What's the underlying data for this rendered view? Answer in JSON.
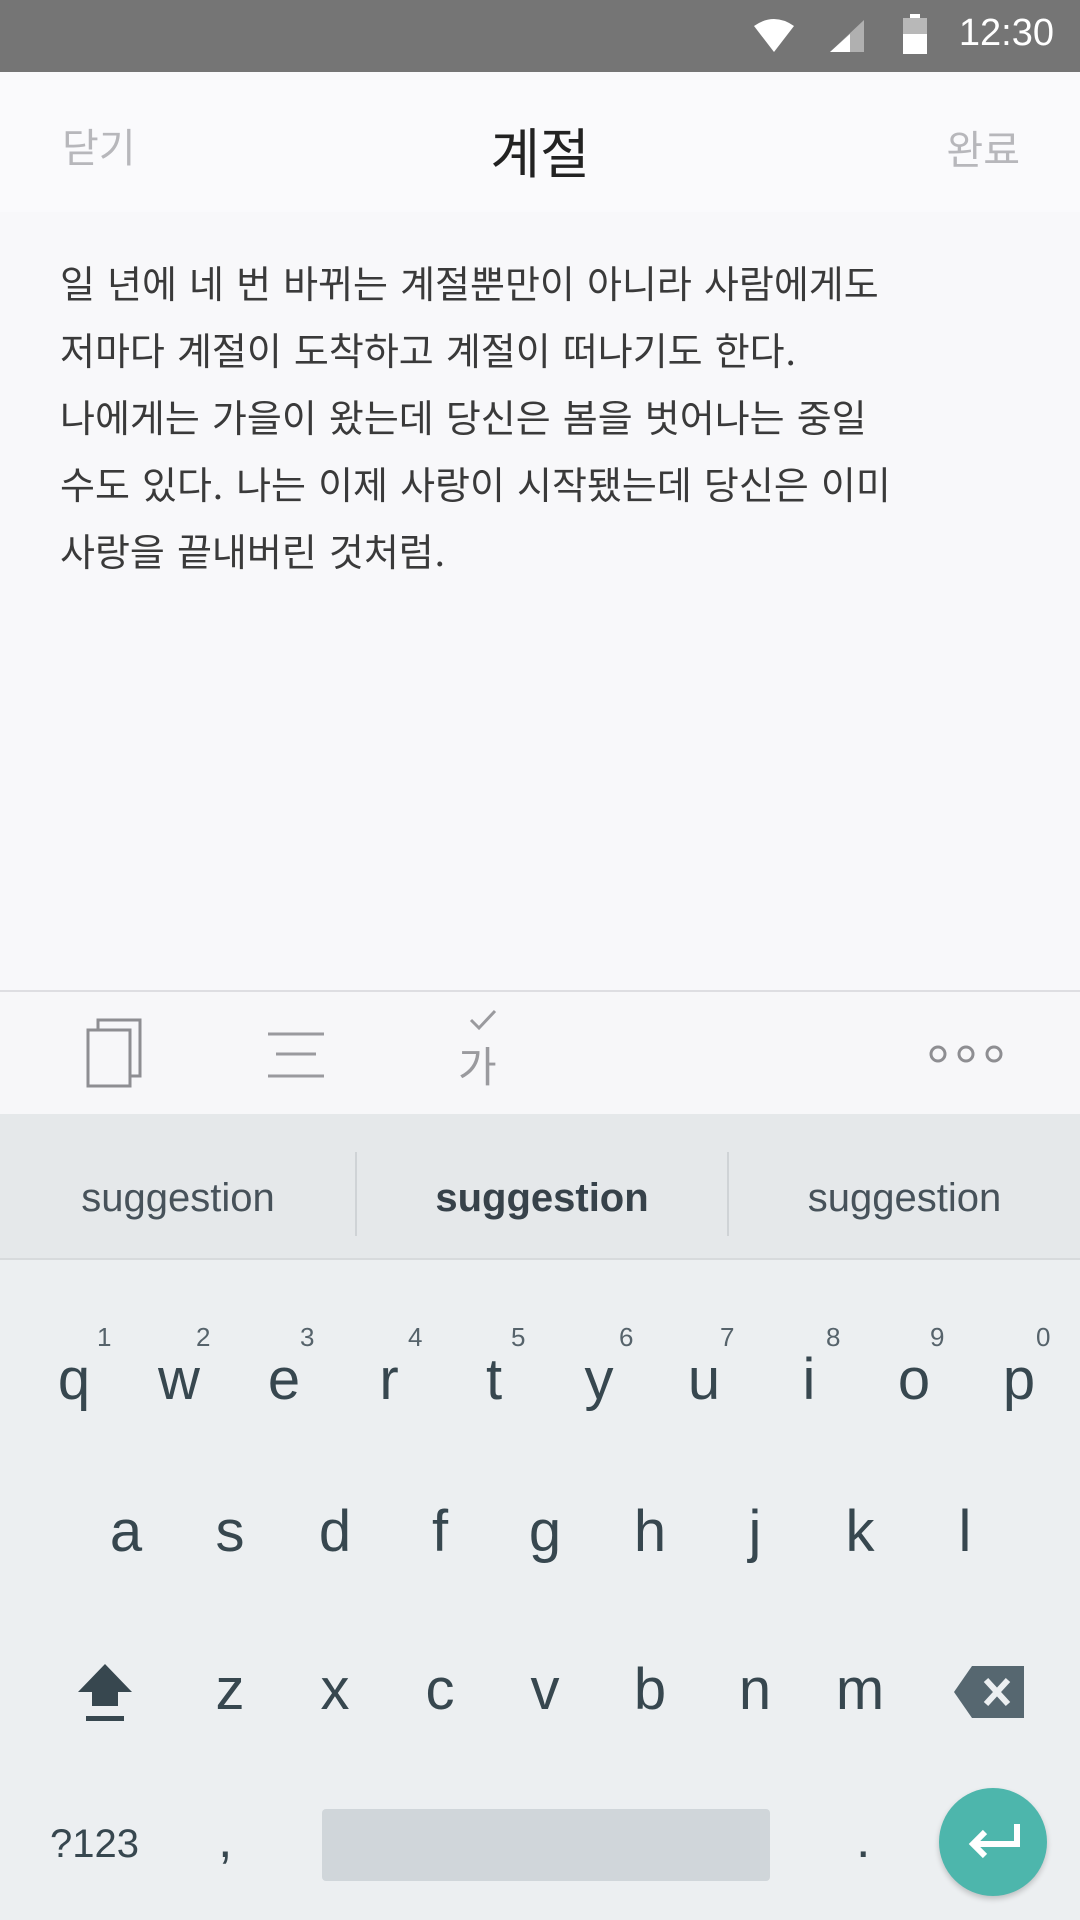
{
  "status_bar": {
    "time": "12:30",
    "icons": [
      "wifi-icon",
      "cell-signal-icon",
      "battery-icon"
    ]
  },
  "header": {
    "close_label": "닫기",
    "title": "계절",
    "done_label": "완료"
  },
  "editor": {
    "lines": [
      "일 년에 네 번 바뀌는 계절뿐만이 아니라 사람에게도",
      "저마다 계절이 도착하고 계절이 떠나기도 한다.",
      "나에게는 가을이 왔는데 당신은 봄을 벗어나는 중일",
      "수도 있다. 나는 이제 사랑이 시작됐는데 당신은 이미",
      "사랑을 끝내버린 것처럼."
    ]
  },
  "toolbar": {
    "tools": [
      "copy-icon",
      "align-icon",
      "spellcheck-icon",
      "more-icon"
    ],
    "spellcheck_glyph": "가"
  },
  "keyboard": {
    "suggestions": [
      "suggestion",
      "suggestion",
      "suggestion"
    ],
    "row1": [
      "q",
      "w",
      "e",
      "r",
      "t",
      "y",
      "u",
      "i",
      "o",
      "p"
    ],
    "row1_hints": [
      "1",
      "2",
      "3",
      "4",
      "5",
      "6",
      "7",
      "8",
      "9",
      "0"
    ],
    "row2": [
      "a",
      "s",
      "d",
      "f",
      "g",
      "h",
      "j",
      "k",
      "l"
    ],
    "row3": [
      "z",
      "x",
      "c",
      "v",
      "b",
      "n",
      "m"
    ],
    "symbols_label": "?123",
    "comma": ",",
    "period": ".",
    "accent_color": "#4db6ac"
  }
}
